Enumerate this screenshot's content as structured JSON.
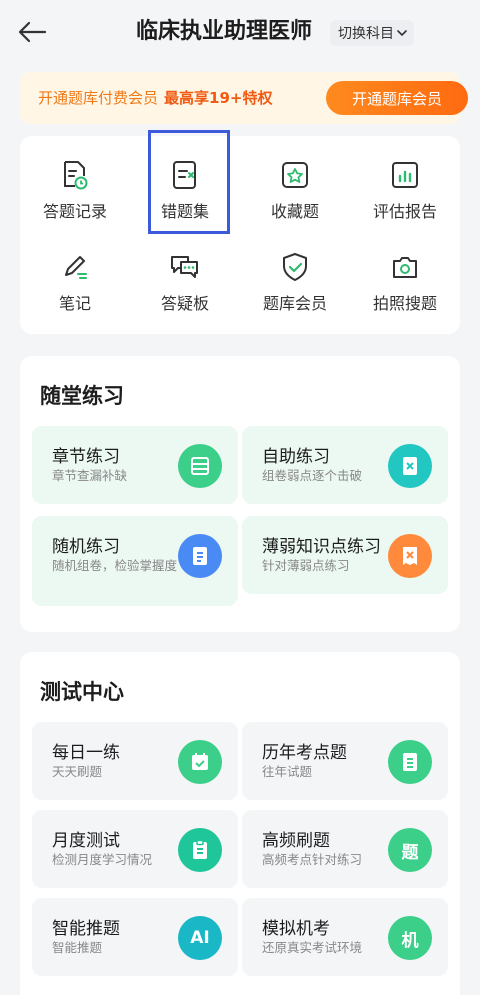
{
  "header": {
    "title": "临床执业助理医师",
    "switch_label": "切换科目"
  },
  "banner": {
    "text": "开通题库付费会员",
    "highlight": "最高享19+特权",
    "button": "开通题库会员"
  },
  "quick_menu": [
    {
      "label": "答题记录",
      "icon": "record-icon"
    },
    {
      "label": "错题集",
      "icon": "wrong-set-icon"
    },
    {
      "label": "收藏题",
      "icon": "star-icon"
    },
    {
      "label": "评估报告",
      "icon": "report-icon"
    },
    {
      "label": "笔记",
      "icon": "pen-icon"
    },
    {
      "label": "答疑板",
      "icon": "chat-icon"
    },
    {
      "label": "题库会员",
      "icon": "shield-icon"
    },
    {
      "label": "拍照搜题",
      "icon": "camera-icon"
    }
  ],
  "practice": {
    "title": "随堂练习",
    "items": [
      {
        "title": "章节练习",
        "subtitle": "章节查漏补缺",
        "icon": "chapter-icon",
        "color": "#3ccf8a"
      },
      {
        "title": "自助练习",
        "subtitle": "组卷弱点逐个击破",
        "icon": "self-practice-icon",
        "color": "#22c7c1"
      },
      {
        "title": "随机练习",
        "subtitle": "随机组卷，检验掌握度",
        "icon": "list-icon",
        "color": "#4a8af4"
      },
      {
        "title": "薄弱知识点练习",
        "subtitle": "针对薄弱点练习",
        "icon": "weak-point-icon",
        "color": "#ff8a3c"
      }
    ]
  },
  "test_center": {
    "title": "测试中心",
    "items": [
      {
        "title": "每日一练",
        "subtitle": "天天刷题",
        "icon": "calendar-icon",
        "color": "#3ccf8a",
        "glyph": ""
      },
      {
        "title": "历年考点题",
        "subtitle": "往年试题",
        "icon": "document-icon",
        "color": "#3ccf8a",
        "glyph": ""
      },
      {
        "title": "月度测试",
        "subtitle": "检测月度学习情况",
        "icon": "clipboard-icon",
        "color": "#1fc69a",
        "glyph": ""
      },
      {
        "title": "高频刷题",
        "subtitle": "高频考点针对练习",
        "icon": "question-icon",
        "color": "#3ccf8a",
        "glyph": "题"
      },
      {
        "title": "智能推题",
        "subtitle": "智能推题",
        "icon": "ai-icon",
        "color": "#1ab7c6",
        "glyph": "AI"
      },
      {
        "title": "模拟机考",
        "subtitle": "还原真实考试环境",
        "icon": "machine-exam-icon",
        "color": "#3ccf8a",
        "glyph": "机"
      }
    ]
  }
}
